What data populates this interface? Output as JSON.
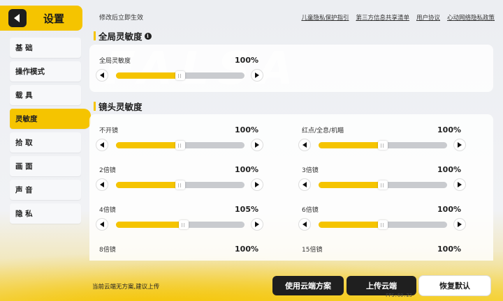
{
  "header": {
    "title": "设置",
    "notice": "修改后立即生效",
    "links": [
      "儿童隐私保护指引",
      "第三方信息共享清单",
      "用户协议",
      "心动网络隐私政策"
    ]
  },
  "sidebar": {
    "items": [
      {
        "label": "基 础",
        "active": false
      },
      {
        "label": "操作模式",
        "active": false
      },
      {
        "label": "载 具",
        "active": false
      },
      {
        "label": "灵敏度",
        "active": true
      },
      {
        "label": "拾 取",
        "active": false
      },
      {
        "label": "画 面",
        "active": false
      },
      {
        "label": "声 音",
        "active": false
      },
      {
        "label": "隐 私",
        "active": false
      }
    ]
  },
  "global_section": {
    "title": "全局灵敏度",
    "sliders": [
      {
        "label": "全局灵敏度",
        "value": "100%",
        "level": 0.5
      }
    ]
  },
  "scope_section": {
    "title": "镜头灵敏度",
    "sliders": [
      {
        "label": "不开镜",
        "value": "100%",
        "level": 0.5
      },
      {
        "label": "红点/全息/机瞄",
        "value": "100%",
        "level": 0.5
      },
      {
        "label": "2倍镜",
        "value": "100%",
        "level": 0.5
      },
      {
        "label": "3倍镜",
        "value": "100%",
        "level": 0.5
      },
      {
        "label": "4倍镜",
        "value": "105%",
        "level": 0.525
      },
      {
        "label": "6倍镜",
        "value": "100%",
        "level": 0.5
      },
      {
        "label": "8倍镜",
        "value": "100%",
        "level": 0.5
      },
      {
        "label": "15倍镜",
        "value": "100%",
        "level": 0.5
      }
    ]
  },
  "footer": {
    "cloud_status": "当前云端无方案,建议上传",
    "buttons": {
      "use_cloud": "使用云端方案",
      "upload_cloud": "上传云端",
      "restore_default": "恢复默认"
    },
    "fps": "FPS:60.23"
  },
  "colors": {
    "accent": "#f5c400",
    "dark": "#1f1f1f",
    "track": "#c9cbcf"
  }
}
